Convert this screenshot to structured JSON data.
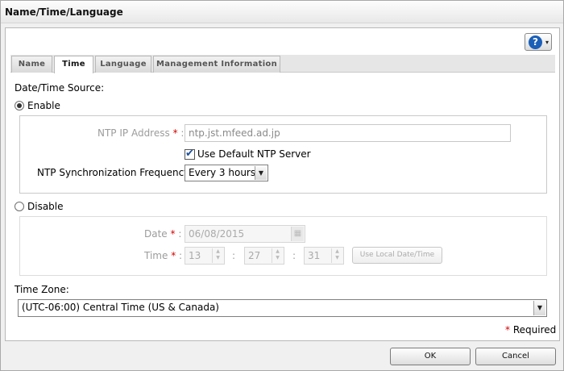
{
  "window": {
    "title": "Name/Time/Language"
  },
  "help": {
    "glyph": "?",
    "caret": "▾"
  },
  "tabs": [
    {
      "label": "Name",
      "active": false
    },
    {
      "label": "Time",
      "active": true
    },
    {
      "label": "Language",
      "active": false
    },
    {
      "label": "Management Information",
      "active": false
    }
  ],
  "source": {
    "label": "Date/Time Source:",
    "enable": {
      "label": "Enable",
      "selected": true
    },
    "disable": {
      "label": "Disable",
      "selected": false
    }
  },
  "ntp": {
    "ip_label": "NTP IP Address",
    "required_mark": "*",
    "colon": ":",
    "ip_value": "ntp.jst.mfeed.ad.jp",
    "use_default_label": "Use Default NTP Server",
    "use_default_checked": true,
    "frequency_label": "NTP Synchronization Frequency:",
    "frequency_value": "Every 3 hours"
  },
  "manual": {
    "date_label": "Date",
    "date_value": "06/08/2015",
    "time_label": "Time",
    "hour": "13",
    "minute": "27",
    "second": "31",
    "time_sep": ":",
    "use_local_button": "Use Local Date/Time"
  },
  "timezone": {
    "label": "Time Zone:",
    "value": "(UTC-06:00) Central Time (US & Canada)"
  },
  "footer": {
    "required_note": "Required",
    "required_mark": "*",
    "ok": "OK",
    "cancel": "Cancel"
  }
}
